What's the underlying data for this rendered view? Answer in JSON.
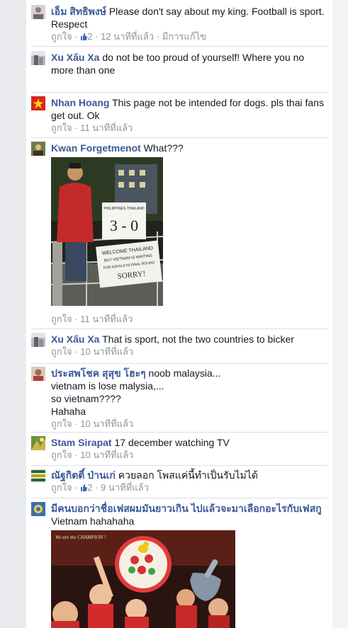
{
  "comments": [
    {
      "author": "เอ็ม สิทธิพงษ์",
      "text": "Please don't say about my king. Football is sport. Respect",
      "like": "ถูกใจ",
      "likes": "2",
      "time": "12 นาทีที่แล้ว",
      "edited": "มีการแก้ไข"
    },
    {
      "author": "Xu Xấu Xa",
      "text": "do not be too proud of yourself! Where you no more than one"
    },
    {
      "author": "Nhan Hoang",
      "text": "This page not be intended for dogs. pls thai fans get out. Ok",
      "like": "ถูกใจ",
      "time": "11 นาทีที่แล้ว"
    },
    {
      "author": "Kwan Forgetmenot",
      "text": "What???",
      "like": "ถูกใจ",
      "time": "11 นาทีที่แล้ว",
      "photo_signs": [
        "PHILIPPINES-THAILAND",
        "3 - 0",
        "WELCOME THAILAND",
        "BUT VIETNAM IS WAITING",
        "FOR AZKALS IN FINAL ROUND",
        "SORRY!"
      ]
    },
    {
      "author": "Xu Xấu Xa",
      "text": "That is sport, not the two countries to bicker",
      "like": "ถูกใจ",
      "time": "10 นาทีที่แล้ว"
    },
    {
      "author": "ประสพโชค สุสุข โฮะๆ",
      "text": "noob malaysia...",
      "lines": [
        "vietnam is lose malysia,...",
        "so vietnam????",
        "Hahaha"
      ],
      "like": "ถูกใจ",
      "time": "10 นาทีที่แล้ว"
    },
    {
      "author": "Stam Sirapat",
      "text": "17 december watching TV",
      "like": "ถูกใจ",
      "time": "10 นาทีที่แล้ว"
    },
    {
      "author": "ณัฐกิตติ์ ป่านเก่",
      "text": "ควยลอก โพสแค่นี้ทำเป็นรับไม่ได้",
      "like": "ถูกใจ",
      "likes": "2",
      "time": "9 นาทีที่แล้ว"
    },
    {
      "author": "มีคนบอกว่าชื่อเฟสผมมันยาวเกิน ไปแล้วจะมาเลือกอะไรกับเฟสกู",
      "text": "Vietnam hahahaha",
      "photo_caption": "We are the CHAMPION !"
    }
  ],
  "colors": {
    "author": "#3b5998",
    "meta": "#90949c",
    "separator": "#dcdee3",
    "like_icon": "#4267b2"
  }
}
